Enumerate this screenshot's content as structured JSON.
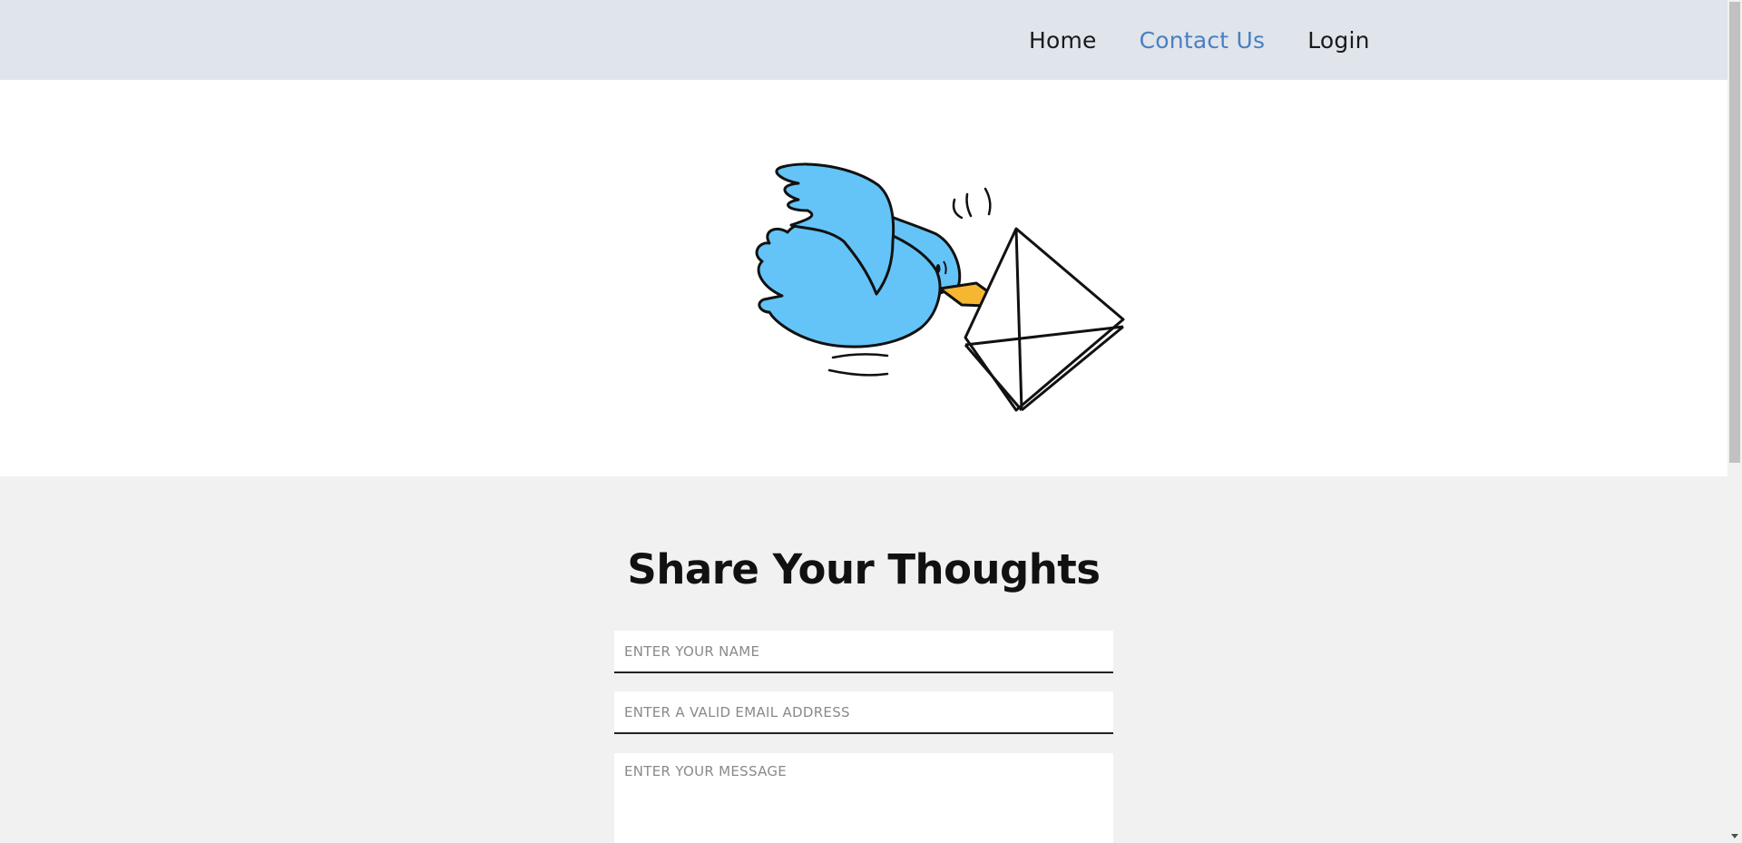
{
  "nav": {
    "items": [
      {
        "label": "Home",
        "active": false
      },
      {
        "label": "Contact Us",
        "active": true
      },
      {
        "label": "Login",
        "active": false
      }
    ]
  },
  "hero": {
    "illustration": "bird-carrying-envelope-icon"
  },
  "form": {
    "title": "Share Your Thoughts",
    "name_placeholder": "ENTER YOUR NAME",
    "email_placeholder": "ENTER A VALID EMAIL ADDRESS",
    "message_placeholder": "ENTER YOUR MESSAGE"
  },
  "colors": {
    "nav_bg": "#e0e4eb",
    "accent": "#4a7fc1",
    "bird": "#64c4f8",
    "beak": "#f5b731"
  }
}
